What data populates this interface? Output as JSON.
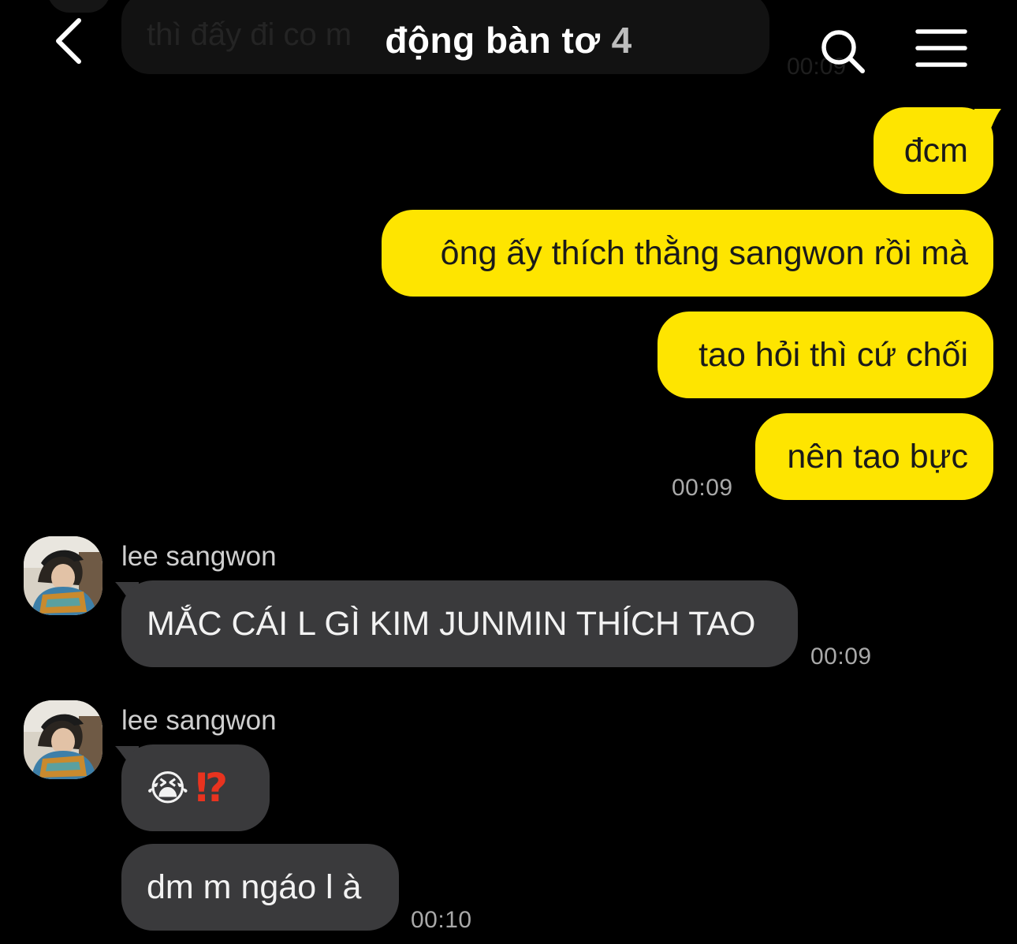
{
  "header": {
    "title": "động bàn tơ",
    "member_count": "4"
  },
  "ghost": {
    "text": "thì đấy đi co m",
    "time": "00:09"
  },
  "outgoing": [
    {
      "text": "đcm"
    },
    {
      "text": "ông ấy thích thằng sangwon rồi mà"
    },
    {
      "text": "tao hỏi thì cứ chối"
    },
    {
      "text": "nên tao bực",
      "time": "00:09"
    }
  ],
  "incoming": [
    {
      "sender": "lee sangwon",
      "text": "MẮC CÁI L GÌ KIM JUNMIN THÍCH TAO",
      "time": "00:09"
    },
    {
      "sender": "lee sangwon",
      "emoji_face": "😭",
      "emoji_mark": "⁉",
      "text2": "dm m ngáo l à",
      "time": "00:10"
    }
  ],
  "colors": {
    "outgoing_bubble": "#fee500",
    "incoming_bubble": "#3a3a3c",
    "background": "#000000"
  },
  "icons": {
    "back": "chevron-left-icon",
    "search": "search-icon",
    "menu": "hamburger-menu-icon"
  }
}
